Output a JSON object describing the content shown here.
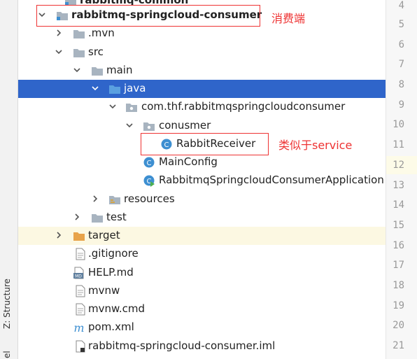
{
  "side_panel": {
    "structure_label": "Z: Structure",
    "bottom_label": "el"
  },
  "tree": {
    "top_item": "rabbitmq-common",
    "project": "rabbitmq-springcloud-consumer",
    "mvn": ".mvn",
    "src": "src",
    "main": "main",
    "java": "java",
    "package": "com.thf.rabbitmqspringcloudconsumer",
    "subpackage": "conusmer",
    "receiver": "RabbitReceiver",
    "mainconfig": "MainConfig",
    "application": "RabbitmqSpringcloudConsumerApplication",
    "resources": "resources",
    "test": "test",
    "target": "target",
    "gitignore": ".gitignore",
    "help": "HELP.md",
    "mvnw": "mvnw",
    "mvnwcmd": "mvnw.cmd",
    "pom": "pom.xml",
    "iml": "rabbitmq-springcloud-consumer.iml"
  },
  "gutter": {
    "line_numbers": [
      "4",
      "5",
      "6",
      "7",
      "8",
      "9",
      "10",
      "11",
      "12",
      "13",
      "14",
      "15",
      "16",
      "17",
      "18",
      "19",
      "20",
      "21"
    ],
    "current_line": "12"
  },
  "annotations": {
    "consumer_note": "消费端",
    "service_note": "类似于service"
  },
  "colors": {
    "selection": "#2f65ca",
    "annotation": "#e33333",
    "folder": "#a8b4c0",
    "source_folder": "#5aa0e0",
    "class_icon": "#3d8fd1"
  }
}
